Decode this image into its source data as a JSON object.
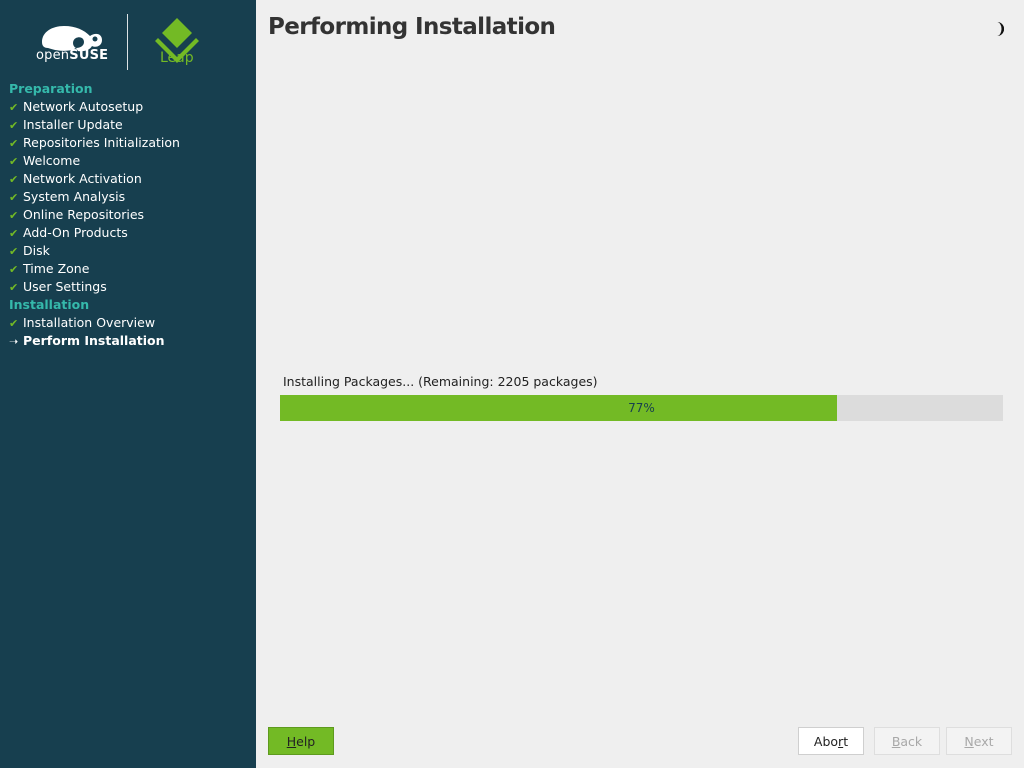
{
  "sidebar": {
    "logo_opensuse_prefix": "open",
    "logo_opensuse_suffix": "SUSE",
    "logo_leap": "Leap",
    "sections": [
      {
        "title": "Preparation",
        "steps": [
          {
            "label": "Network Autosetup",
            "status": "done"
          },
          {
            "label": "Installer Update",
            "status": "done"
          },
          {
            "label": "Repositories Initialization",
            "status": "done"
          },
          {
            "label": "Welcome",
            "status": "done"
          },
          {
            "label": "Network Activation",
            "status": "done"
          },
          {
            "label": "System Analysis",
            "status": "done"
          },
          {
            "label": "Online Repositories",
            "status": "done"
          },
          {
            "label": "Add-On Products",
            "status": "done"
          },
          {
            "label": "Disk",
            "status": "done"
          },
          {
            "label": "Time Zone",
            "status": "done"
          },
          {
            "label": "User Settings",
            "status": "done"
          }
        ]
      },
      {
        "title": "Installation",
        "steps": [
          {
            "label": "Installation Overview",
            "status": "done"
          },
          {
            "label": "Perform Installation",
            "status": "current"
          }
        ]
      }
    ],
    "done_icon": "check-icon",
    "current_icon": "arrow-right-icon"
  },
  "main": {
    "title": "Performing Installation",
    "theme_icon": "half-moon-icon",
    "progress": {
      "label": "Installing Packages... (Remaining: 2205 packages)",
      "percent": 77,
      "percent_text": "77%"
    }
  },
  "buttons": {
    "help": {
      "mnemonic": "H",
      "rest": "elp"
    },
    "abort": {
      "before": "Abo",
      "mnemonic": "r",
      "rest": "t"
    },
    "back": {
      "mnemonic": "B",
      "rest": "ack"
    },
    "next": {
      "mnemonic": "N",
      "rest": "ext"
    }
  },
  "colors": {
    "sidebar_bg": "#173f4f",
    "accent_green": "#73ba25",
    "section_header": "#35b9ab"
  }
}
